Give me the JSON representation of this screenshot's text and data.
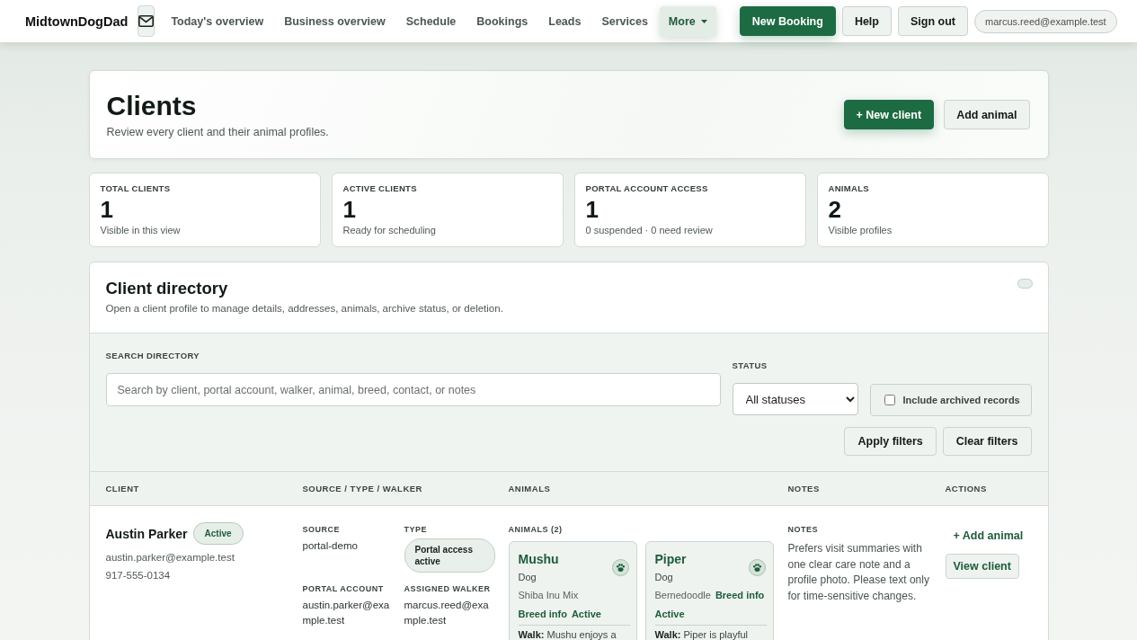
{
  "nav": {
    "brand": "MidtownDogDad",
    "links": [
      {
        "label": "Today's overview",
        "kind": "link",
        "selected": false
      },
      {
        "label": "Business overview",
        "kind": "link",
        "selected": false
      },
      {
        "label": "Schedule",
        "kind": "link",
        "selected": false
      },
      {
        "label": "Bookings",
        "kind": "link",
        "selected": false
      },
      {
        "label": "Leads",
        "kind": "link",
        "selected": false
      },
      {
        "label": "Services",
        "kind": "link",
        "selected": false
      },
      {
        "label": "More",
        "kind": "menu",
        "selected": true
      }
    ],
    "buttons": [
      {
        "label": "New Booking",
        "kind": "primary"
      },
      {
        "label": "Help",
        "kind": "secondary"
      },
      {
        "label": "Sign out",
        "kind": "secondary"
      }
    ],
    "account": "marcus.reed@example.test"
  },
  "header": {
    "title": "Clients",
    "subtitle": "Review every client and their animal profiles.",
    "buttons": [
      {
        "label": "+ New client",
        "kind": "primary"
      },
      {
        "label": "Add animal",
        "kind": "secondary"
      }
    ]
  },
  "stats": [
    {
      "label": "TOTAL CLIENTS",
      "value": "1",
      "note": "Visible in this view"
    },
    {
      "label": "ACTIVE CLIENTS",
      "value": "1",
      "note": "Ready for scheduling"
    },
    {
      "label": "PORTAL ACCOUNT ACCESS",
      "value": "1",
      "note": "0 suspended · 0 need review"
    },
    {
      "label": "ANIMALS",
      "value": "2",
      "note": "Visible profiles"
    }
  ],
  "directory": {
    "title": "Client directory",
    "description": "Open a client profile to manage details, addresses, animals, archive status, or deletion.",
    "filters": {
      "search": {
        "label": "SEARCH DIRECTORY",
        "placeholder": "Search by client, portal account, walker, animal, breed, contact, or notes"
      },
      "status": {
        "label": "STATUS",
        "value": "All statuses"
      },
      "archived": {
        "label": "Include archived records",
        "checked": false
      },
      "buttons": [
        {
          "label": "Apply filters",
          "kind": "secondary"
        },
        {
          "label": "Clear filters",
          "kind": "secondary"
        }
      ]
    },
    "table": {
      "columns": [
        "CLIENT",
        "SOURCE / TYPE / WALKER",
        "ANIMALS",
        "NOTES",
        "ACTIONS"
      ],
      "rows": [
        {
          "client": {
            "name": "Austin Parker",
            "status": "Active",
            "email": "austin.parker@example.test",
            "phone": "917-555-0134"
          },
          "details": [
            {
              "label": "SOURCE",
              "value": "portal-demo",
              "kind": "text"
            },
            {
              "label": "TYPE",
              "value": "Portal access active",
              "kind": "badge"
            },
            {
              "label": "PORTAL ACCOUNT",
              "value": "austin.parker@example.test",
              "kind": "text"
            },
            {
              "label": "ASSIGNED WALKER",
              "value": "marcus.reed@example.test",
              "kind": "text"
            }
          ],
          "animals_label": "ANIMALS (2)",
          "animals": [
            {
              "name": "Mushu",
              "species": "Dog",
              "breed": "Shiba Inu Mix",
              "breed_link": "Breed info",
              "status": "Active",
              "walk": "**Walk:** Mushu enjoys a"
            },
            {
              "name": "Piper",
              "species": "Dog",
              "breed": "Bernedoodle",
              "breed_link": "Breed info",
              "status": "Active",
              "walk": "**Walk:** Piper is playful"
            }
          ],
          "notes_label": "NOTES",
          "notes": "Prefers visit summaries with one clear care note and a profile photo. Please text only for time-sensitive changes.",
          "actions": [
            {
              "label": "+ Add animal",
              "kind": "link"
            },
            {
              "label": "View client",
              "kind": "secondary"
            }
          ]
        }
      ]
    }
  }
}
